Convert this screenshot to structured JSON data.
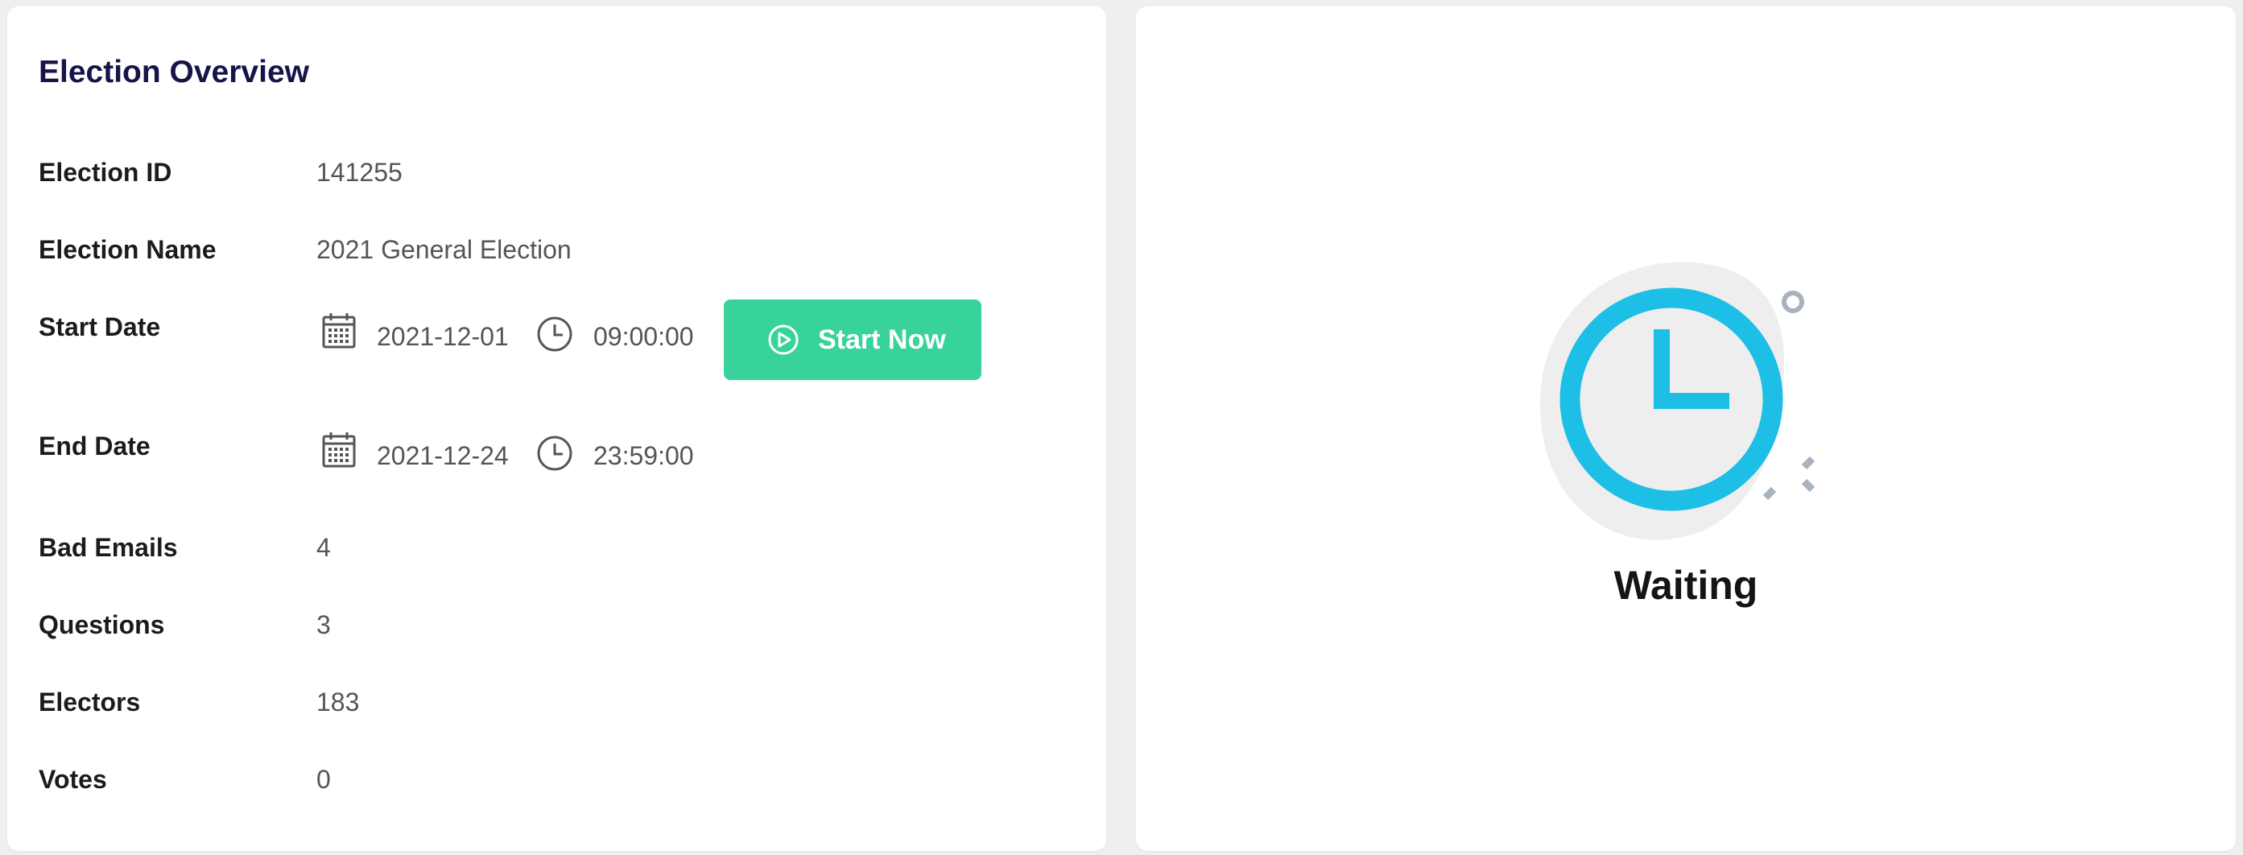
{
  "overview": {
    "title": "Election Overview",
    "election_id_label": "Election ID",
    "election_id": "141255",
    "election_name_label": "Election Name",
    "election_name": "2021 General Election",
    "start_date_label": "Start Date",
    "start_date": "2021-12-01",
    "start_time": "09:00:00",
    "start_button_label": "Start Now",
    "end_date_label": "End Date",
    "end_date": "2021-12-24",
    "end_time": "23:59:00",
    "bad_emails_label": "Bad Emails",
    "bad_emails": "4",
    "questions_label": "Questions",
    "questions": "3",
    "electors_label": "Electors",
    "electors": "183",
    "votes_label": "Votes",
    "votes": "0"
  },
  "status": {
    "label": "Waiting",
    "icon": "clock-icon"
  },
  "colors": {
    "title": "#161449",
    "accent_green": "#38d39b",
    "clock_blue": "#1dbfe6",
    "blob_gray": "#eeeeee",
    "decor_gray": "#a9b2bf"
  }
}
